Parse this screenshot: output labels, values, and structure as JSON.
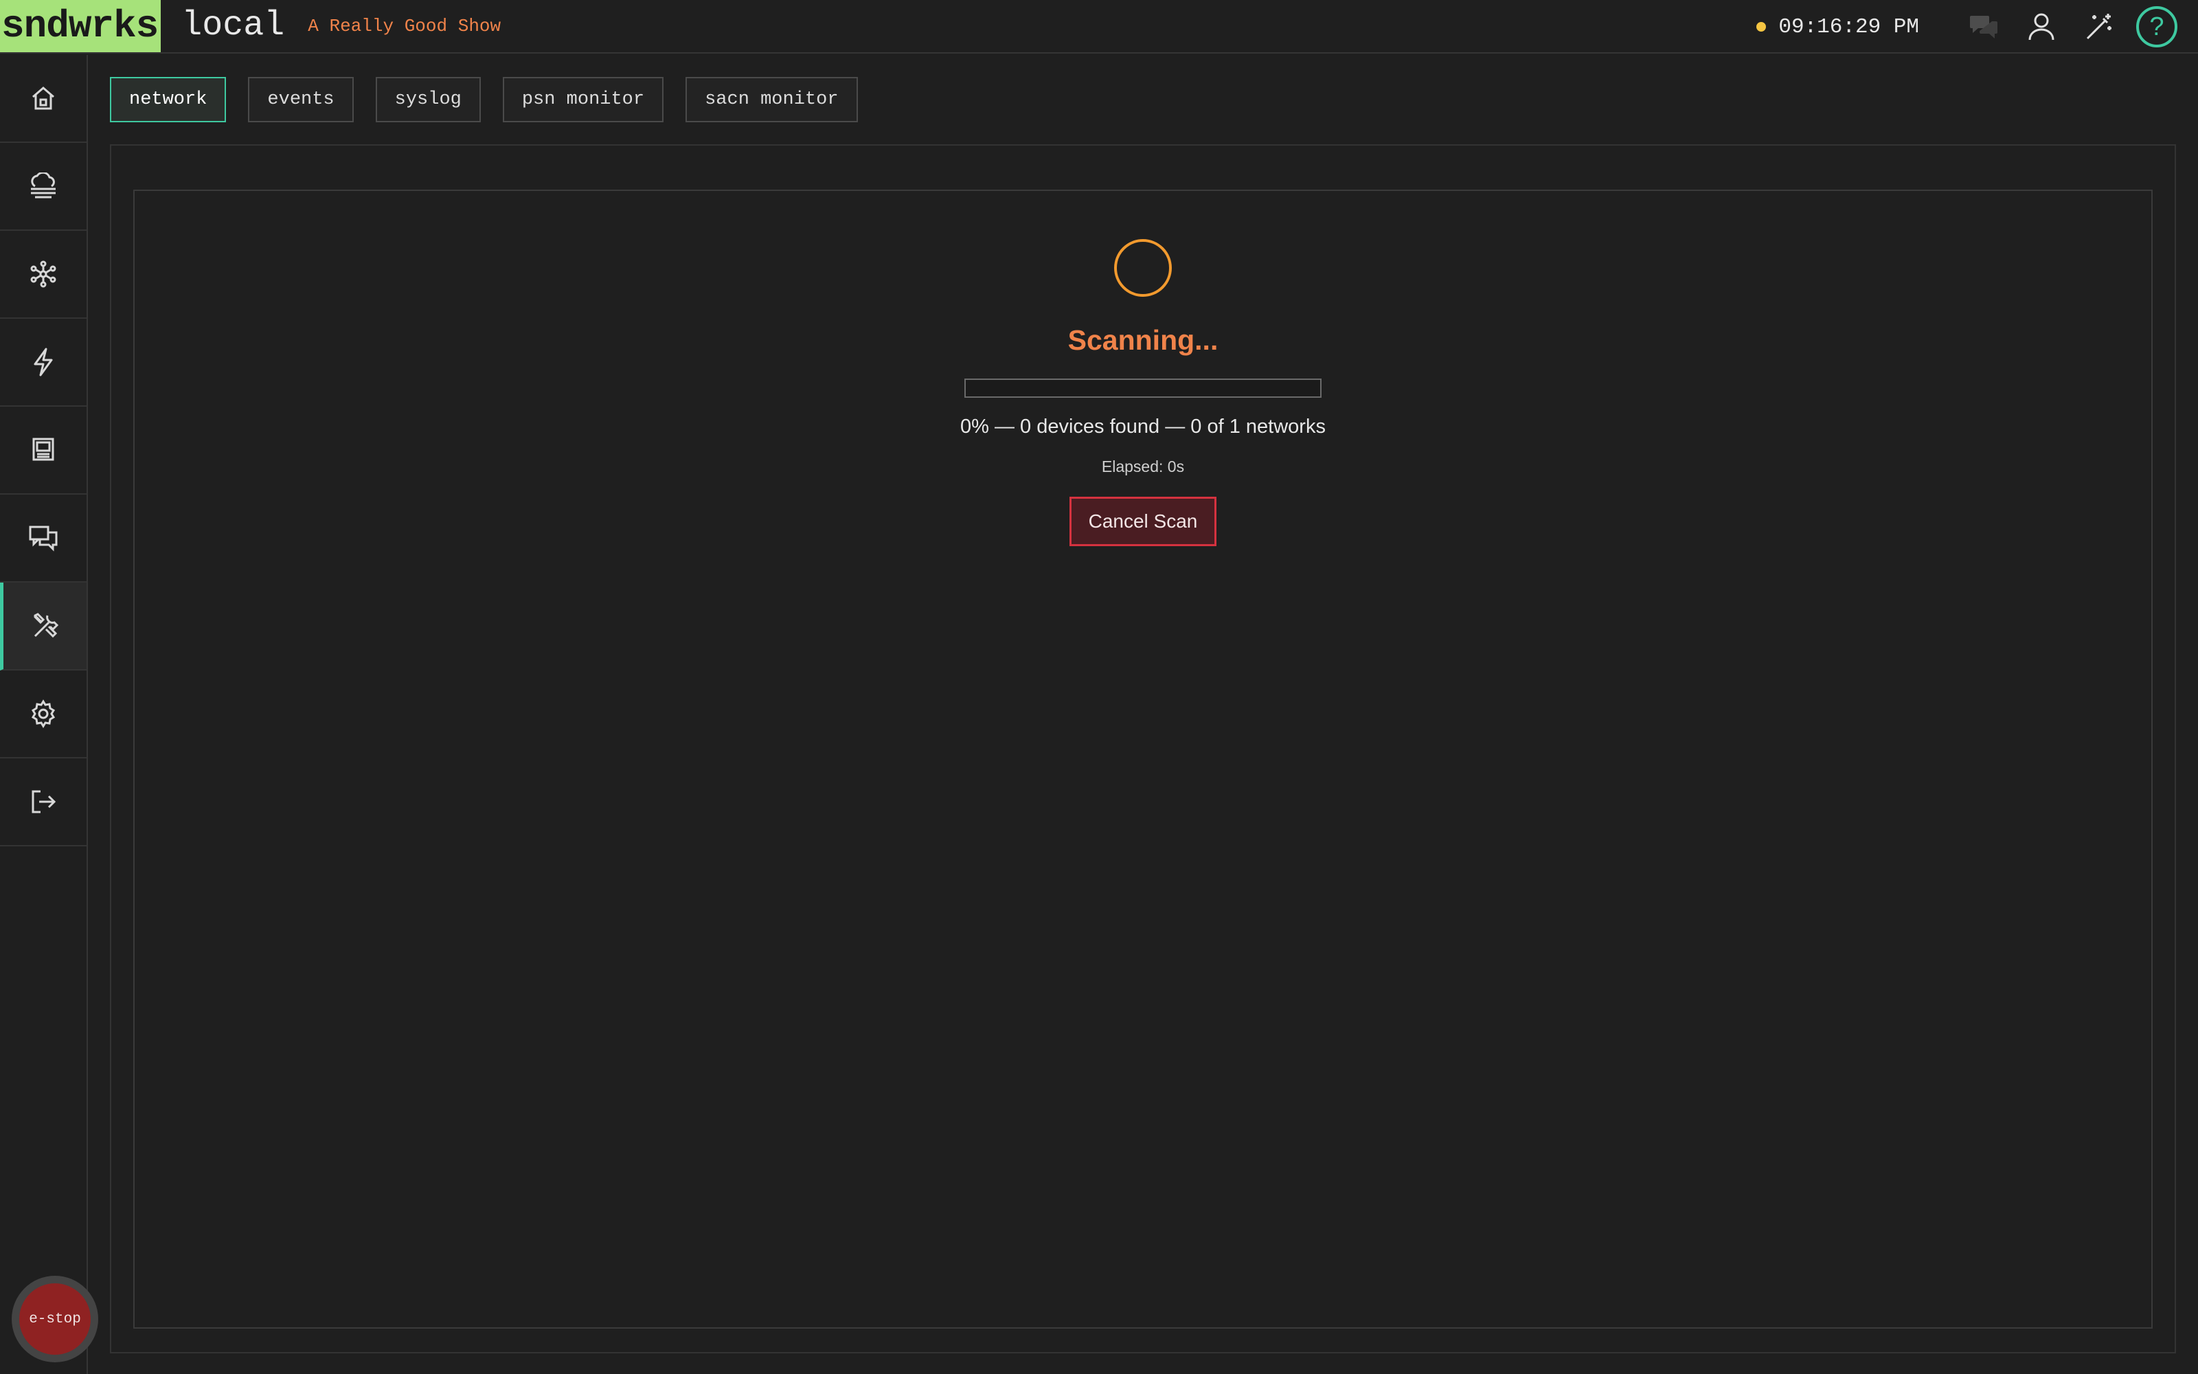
{
  "header": {
    "logo": "sndwrks",
    "venue": "local",
    "show_name": "A Really Good Show",
    "clock": "09:16:29 PM",
    "status_color": "#f5c542",
    "icons": [
      "chat-icon",
      "user-icon",
      "magic-wand-icon",
      "help-icon"
    ],
    "help_glyph": "?"
  },
  "sidebar": {
    "items": [
      {
        "name": "home",
        "icon": "home-icon"
      },
      {
        "name": "devices",
        "icon": "cloud-stack-icon"
      },
      {
        "name": "network-graph",
        "icon": "network-nodes-icon"
      },
      {
        "name": "power",
        "icon": "lightning-icon"
      },
      {
        "name": "console",
        "icon": "monitor-icon"
      },
      {
        "name": "messages",
        "icon": "chat-bubbles-icon"
      },
      {
        "name": "tools",
        "icon": "tools-icon",
        "active": true
      },
      {
        "name": "settings",
        "icon": "gear-icon"
      },
      {
        "name": "logout",
        "icon": "logout-icon"
      }
    ],
    "estop_label": "e-stop"
  },
  "tabs": [
    {
      "label": "network",
      "active": true
    },
    {
      "label": "events"
    },
    {
      "label": "syslog"
    },
    {
      "label": "psn monitor"
    },
    {
      "label": "sacn monitor"
    }
  ],
  "scan": {
    "title": "Scanning...",
    "progress": 0,
    "stats": "0% — 0 devices found — 0 of 1 networks",
    "elapsed": "Elapsed: 0s",
    "cancel_label": "Cancel Scan"
  },
  "colors": {
    "accent": "#3ec9a0",
    "warning": "#f0834a",
    "danger": "#d5323f",
    "logo_bg": "#a6e27a"
  }
}
